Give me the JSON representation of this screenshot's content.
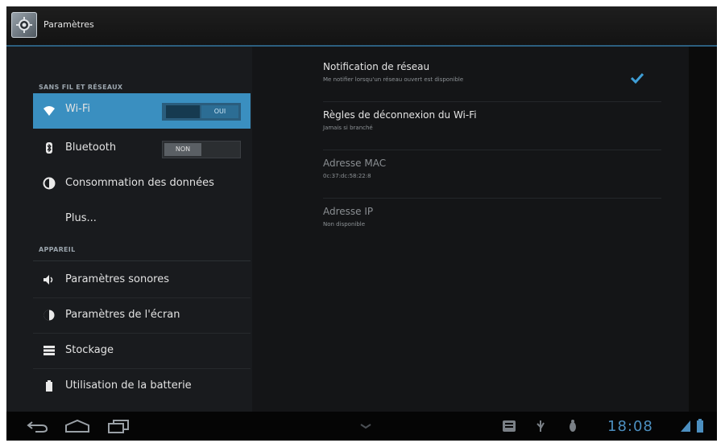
{
  "actionbar": {
    "title": "Paramètres",
    "icon": "settings-gear-icon"
  },
  "sidebar": {
    "section_wireless": "SANS FIL ET RÉSEAUX",
    "section_device": "APPAREIL",
    "items": [
      {
        "label": "Wi-Fi",
        "icon": "wifi-icon",
        "toggle": "OUI",
        "selected": true
      },
      {
        "label": "Bluetooth",
        "icon": "bluetooth-icon",
        "toggle": "NON"
      },
      {
        "label": "Consommation des données",
        "icon": "data-usage-icon"
      },
      {
        "label": "Plus..."
      },
      {
        "label": "Paramètres sonores",
        "icon": "volume-icon"
      },
      {
        "label": "Paramètres de l'écran",
        "icon": "brightness-icon"
      },
      {
        "label": "Stockage",
        "icon": "storage-icon"
      },
      {
        "label": "Utilisation de la batterie",
        "icon": "battery-icon"
      }
    ]
  },
  "detail": {
    "rows": [
      {
        "title": "Notification de réseau",
        "summary": "Me notifier lorsqu'un réseau ouvert est disponible",
        "checked": true
      },
      {
        "title": "Règles de déconnexion du Wi-Fi",
        "summary": "Jamais si branché"
      },
      {
        "title": "Adresse MAC",
        "summary": "0c:37:dc:58:22:8"
      },
      {
        "title": "Adresse IP",
        "summary": "Non disponible"
      }
    ]
  },
  "navbar": {
    "time": "18:08"
  },
  "colors": {
    "accent": "#3a8fc0",
    "clock": "#4c8fc0",
    "check": "#3f9ed6"
  }
}
